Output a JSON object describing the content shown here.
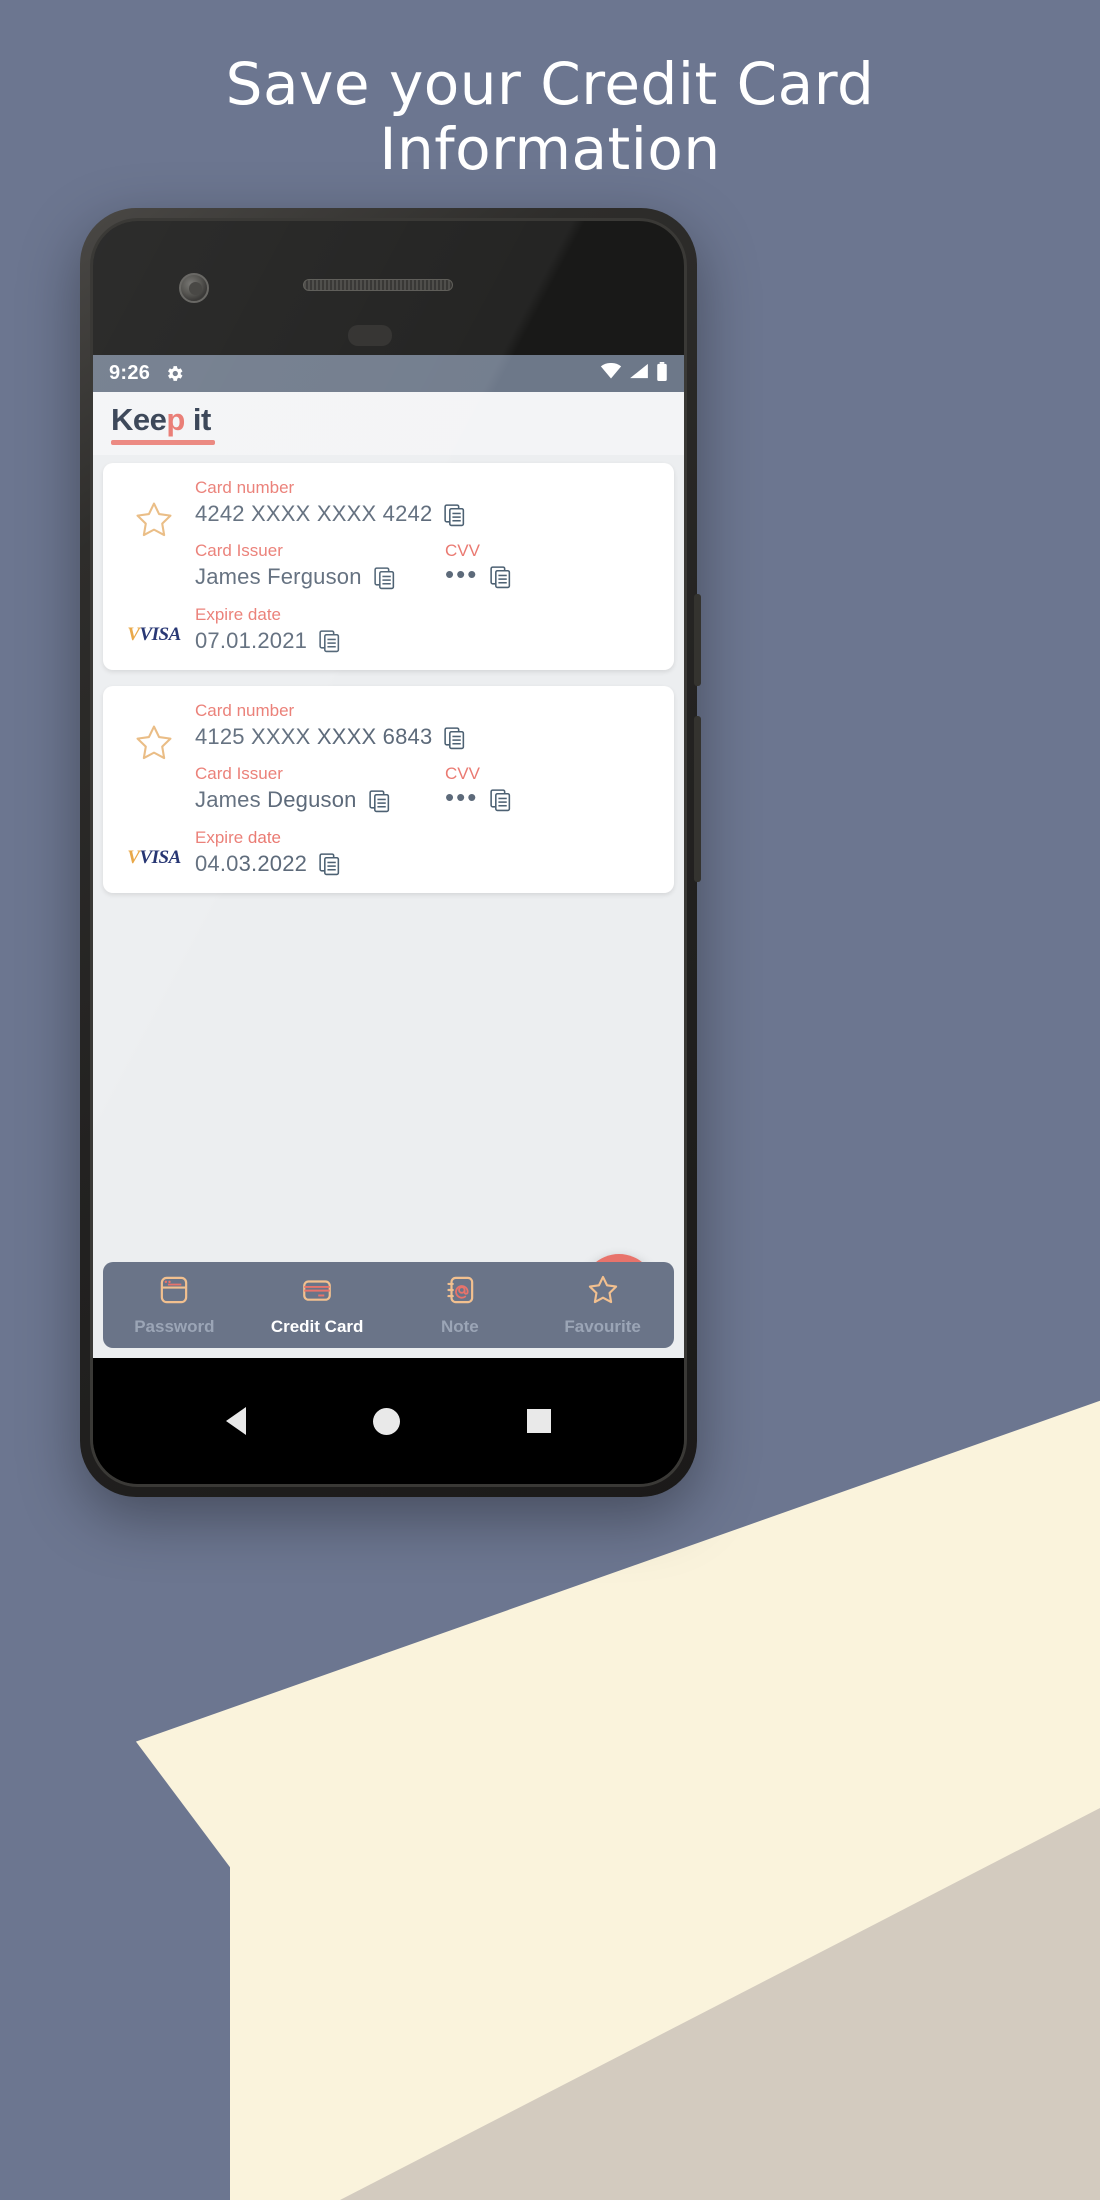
{
  "headline": {
    "line1": "Save your Credit Card",
    "line2": "Information"
  },
  "colors": {
    "background": "#6c7690",
    "cream": "#faf3dc",
    "taupe": "#d3cbbf",
    "accent": "#e8736b",
    "label": "#ea7a72",
    "value": "#5d6a7a",
    "nav_bar": "#6a7488",
    "status_bar": "#6d7889",
    "star": "#e9b97e",
    "visa_blue": "#1a2a6b"
  },
  "status_bar": {
    "time": "9:26",
    "gear_icon": "gear-icon",
    "wifi_icon": "wifi-icon",
    "signal_icon": "signal-icon",
    "battery_icon": "battery-icon"
  },
  "app_bar": {
    "logo_part1": "Kee",
    "logo_part2": "p",
    "logo_part3": " it"
  },
  "labels": {
    "card_number": "Card number",
    "card_issuer": "Card Issuer",
    "cvv": "CVV",
    "expire_date": "Expire date",
    "copy_icon": "copy-icon",
    "star_icon": "star-outline-icon",
    "visa_brand": "VISA"
  },
  "cards": [
    {
      "card_number": "4242 XXXX XXXX 4242",
      "card_issuer": "James Ferguson",
      "cvv": "•••",
      "expire_date": "07.01.2021",
      "brand": "VISA",
      "favourite": false
    },
    {
      "card_number": "4125 XXXX XXXX 6843",
      "card_issuer": "James Deguson",
      "cvv": "•••",
      "expire_date": "04.03.2022",
      "brand": "VISA",
      "favourite": false
    }
  ],
  "fab": {
    "label": "+"
  },
  "bottom_nav": {
    "items": [
      {
        "label": "Password",
        "icon": "password-window-icon",
        "active": false
      },
      {
        "label": "Credit Card",
        "icon": "credit-card-icon",
        "active": true
      },
      {
        "label": "Note",
        "icon": "note-at-icon",
        "active": false
      },
      {
        "label": "Favourite",
        "icon": "star-outline-icon",
        "active": false
      }
    ]
  },
  "android_nav": {
    "back": "back-triangle-icon",
    "home": "home-circle-icon",
    "recents": "recents-square-icon"
  }
}
